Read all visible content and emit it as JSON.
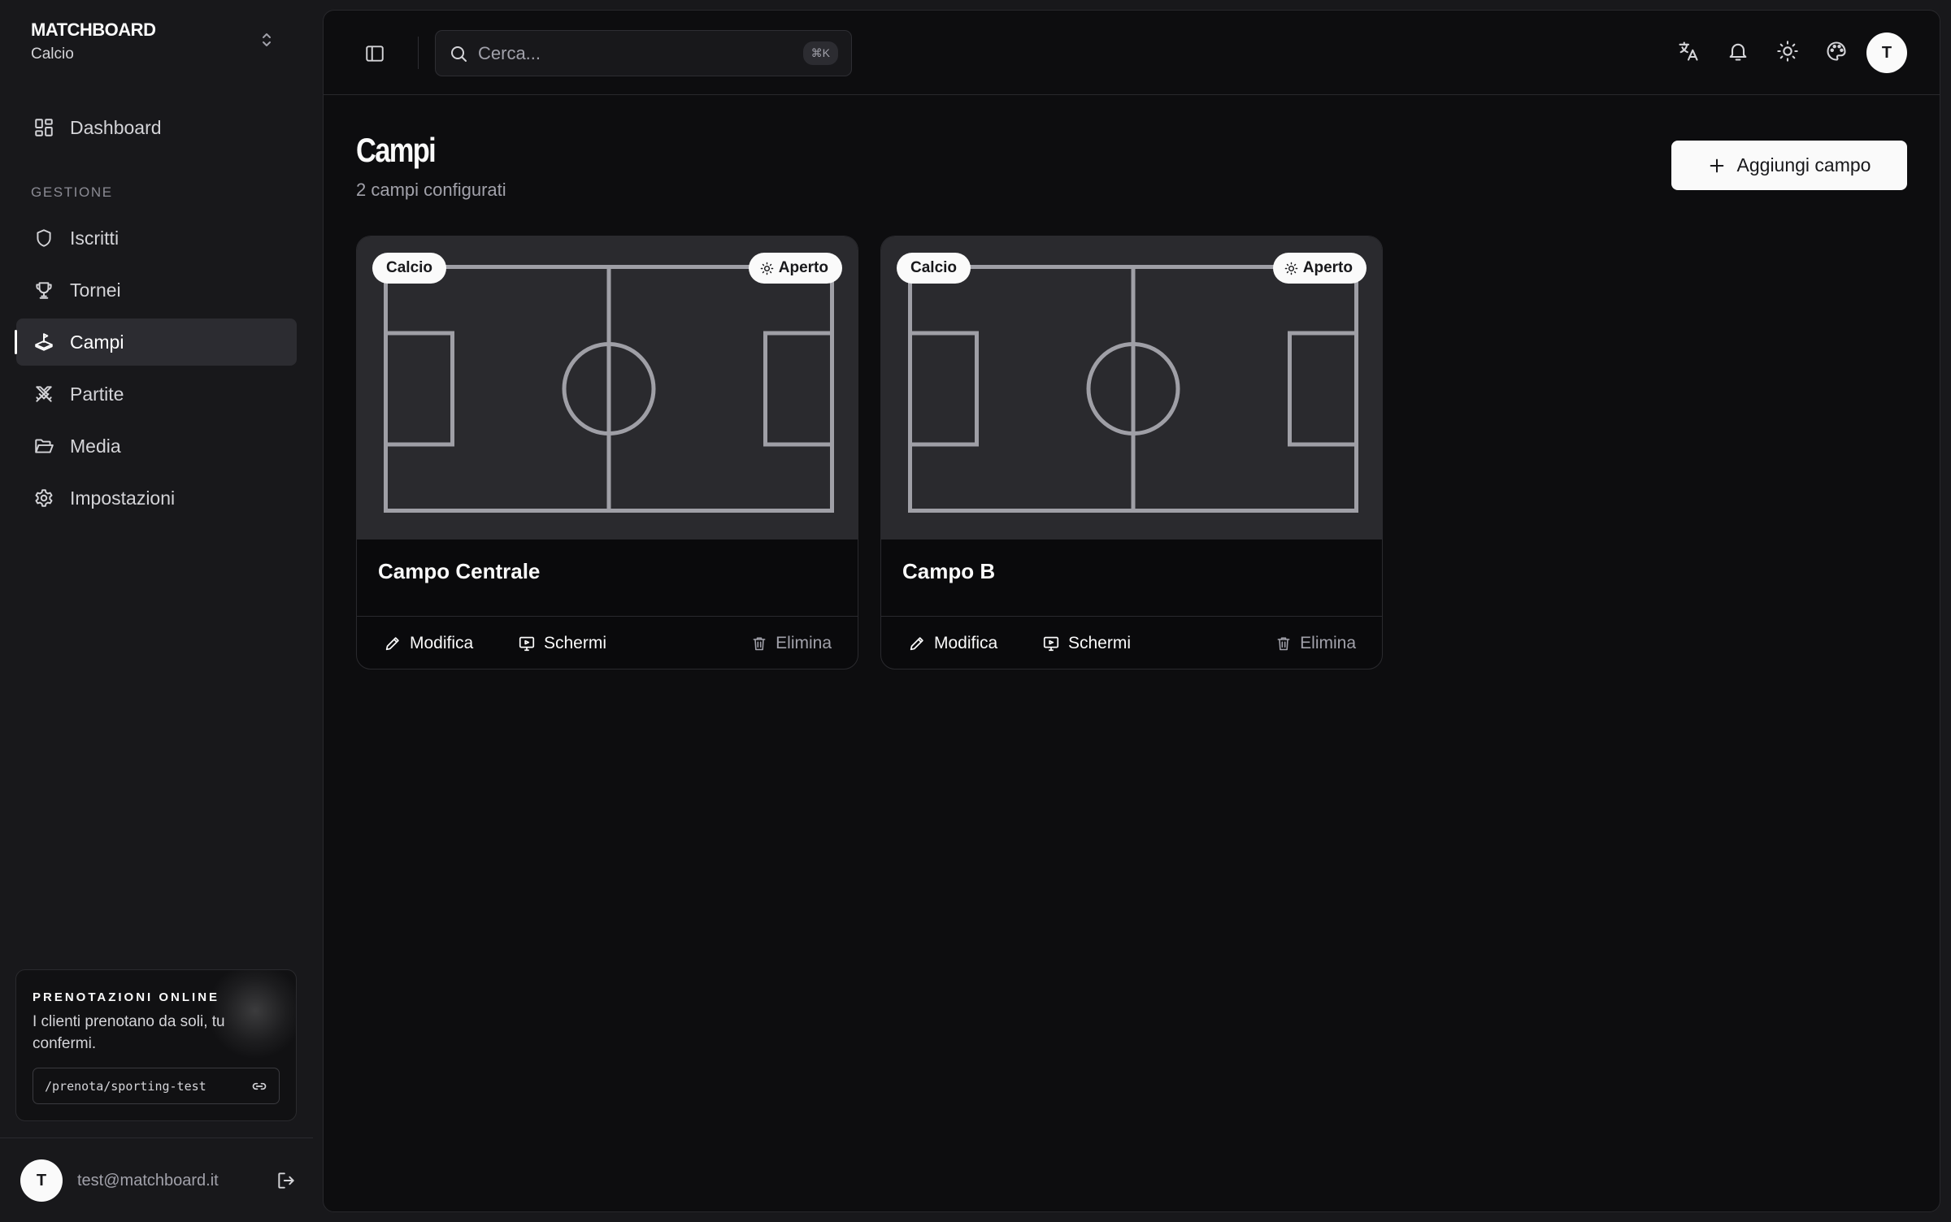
{
  "brand": {
    "name": "MATCHBOARD",
    "sport": "Calcio"
  },
  "sidebar": {
    "items": [
      {
        "label": "Dashboard",
        "icon": "dashboard-icon"
      },
      {
        "label": "Iscritti",
        "icon": "shield-icon"
      },
      {
        "label": "Tornei",
        "icon": "trophy-icon"
      },
      {
        "label": "Campi",
        "icon": "field-icon",
        "active": true
      },
      {
        "label": "Partite",
        "icon": "swords-icon"
      },
      {
        "label": "Media",
        "icon": "folder-icon"
      },
      {
        "label": "Impostazioni",
        "icon": "settings-icon"
      }
    ],
    "section_label": "GESTIONE"
  },
  "promo": {
    "title": "PRENOTAZIONI ONLINE",
    "text": "I clienti prenotano da soli, tu confermi.",
    "link": "/prenota/sporting-test"
  },
  "user": {
    "initial": "T",
    "email": "test@matchboard.it"
  },
  "topbar": {
    "search_placeholder": "Cerca...",
    "shortcut": "⌘K",
    "avatar_initial": "T",
    "icons": [
      "translate-icon",
      "bell-icon",
      "sun-icon",
      "palette-icon"
    ]
  },
  "page": {
    "title": "Campi",
    "subtitle": "2 campi configurati",
    "add_button": "Aggiungi campo"
  },
  "fields": [
    {
      "name": "Campo Centrale",
      "sport": "Calcio",
      "status": "Aperto"
    },
    {
      "name": "Campo B",
      "sport": "Calcio",
      "status": "Aperto"
    }
  ],
  "card_actions": {
    "edit": "Modifica",
    "screens": "Schermi",
    "delete": "Elimina"
  },
  "colors": {
    "background": "#18181b",
    "panel": "#0d0d0f",
    "active_nav": "#2c2c31",
    "card_visual": "#2a2a2e",
    "pitch_lines": "#9f9fa6",
    "text_primary": "#fafafa",
    "text_muted": "#a1a1aa"
  }
}
